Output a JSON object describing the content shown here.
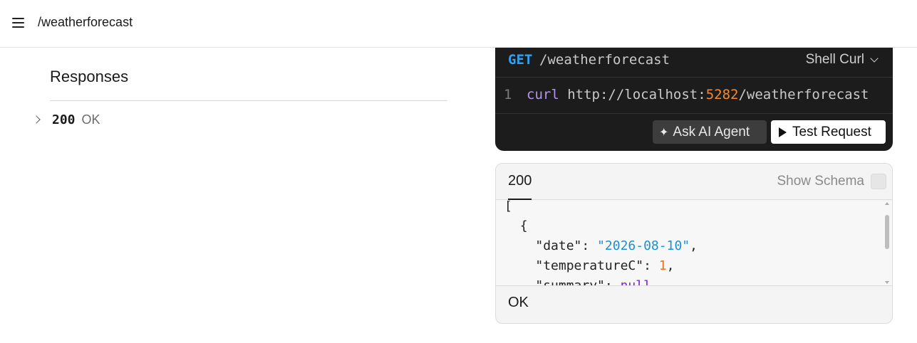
{
  "topbar": {
    "title": "/weatherforecast"
  },
  "left": {
    "heading": "Responses",
    "response": {
      "code": "200",
      "text": "OK"
    }
  },
  "request": {
    "method": "GET",
    "path": "/weatherforecast",
    "language": "Shell Curl",
    "line_number": "1",
    "code": {
      "command": "curl",
      "url_prefix": "http://localhost:",
      "port": "5282",
      "url_suffix": "/weatherforecast"
    },
    "ask_button": "Ask AI Agent",
    "test_button": "Test Request"
  },
  "response_panel": {
    "tab": "200",
    "show_schema_label": "Show Schema",
    "show_schema_checked": false,
    "json": {
      "open_bracket": "[",
      "open_brace": "{",
      "date_key": "\"date\"",
      "date_value": "\"2026-08-10\"",
      "temp_key": "\"temperatureC\"",
      "temp_value": "1",
      "summary_key": "\"summary\"",
      "summary_value": "null"
    },
    "footer": "OK"
  },
  "colors": {
    "method": "#2fa2f0",
    "curl_keyword": "#b694f3",
    "port": "#f28a2f",
    "json_string": "#1f8fd1",
    "json_number": "#f06f1e",
    "json_null": "#7a24c9"
  }
}
